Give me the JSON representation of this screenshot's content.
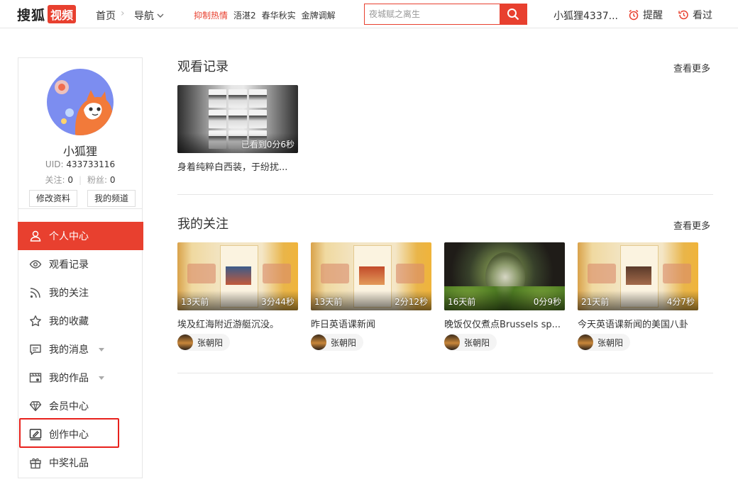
{
  "header": {
    "logo_text": "搜狐",
    "logo_box": "视频",
    "nav_home": "首页",
    "nav_guide": "导航",
    "hot_label": "抑制热情",
    "hot_items": [
      "浯湛2",
      "春华秋实",
      "金牌调解"
    ],
    "search_placeholder": "夜城赋之离生",
    "user_name": "小狐狸4337...",
    "remind_label": "提醒",
    "history_label": "看过"
  },
  "profile": {
    "nickname": "小狐狸",
    "uid_label": "UID:",
    "uid_value": "433733116",
    "follow_label": "关注:",
    "follow_count": "0",
    "fans_label": "粉丝:",
    "fans_count": "0",
    "edit_button": "修改资料",
    "channel_button": "我的频道"
  },
  "menu": [
    {
      "label": "个人中心",
      "icon": "user-icon",
      "active": true
    },
    {
      "label": "观看记录",
      "icon": "eye-icon"
    },
    {
      "label": "我的关注",
      "icon": "rss-icon"
    },
    {
      "label": "我的收藏",
      "icon": "star-icon"
    },
    {
      "label": "我的消息",
      "icon": "message-icon",
      "dropdown": true
    },
    {
      "label": "我的作品",
      "icon": "works-icon",
      "dropdown": true
    },
    {
      "label": "会员中心",
      "icon": "diamond-icon"
    },
    {
      "label": "创作中心",
      "icon": "create-icon"
    },
    {
      "label": "中奖礼品",
      "icon": "gift-icon"
    }
  ],
  "history": {
    "title": "观看记录",
    "more": "查看更多",
    "items": [
      {
        "progress": "已看到0分6秒",
        "title": "身着纯粹白西装，于纷扰..."
      }
    ]
  },
  "follows": {
    "title": "我的关注",
    "more": "查看更多",
    "items": [
      {
        "ago": "13天前",
        "duration": "3分44秒",
        "title": "埃及红海附近游艇沉没。",
        "author": "张朝阳"
      },
      {
        "ago": "13天前",
        "duration": "2分12秒",
        "title": "昨日英语课新闻",
        "author": "张朝阳"
      },
      {
        "ago": "16天前",
        "duration": "0分9秒",
        "title": "晚饭仅仅煮点Brussels sp...",
        "author": "张朝阳"
      },
      {
        "ago": "21天前",
        "duration": "4分7秒",
        "title": "今天英语课新闻的美国八卦",
        "author": "张朝阳"
      }
    ]
  },
  "colors": {
    "accent": "#e8402f"
  }
}
